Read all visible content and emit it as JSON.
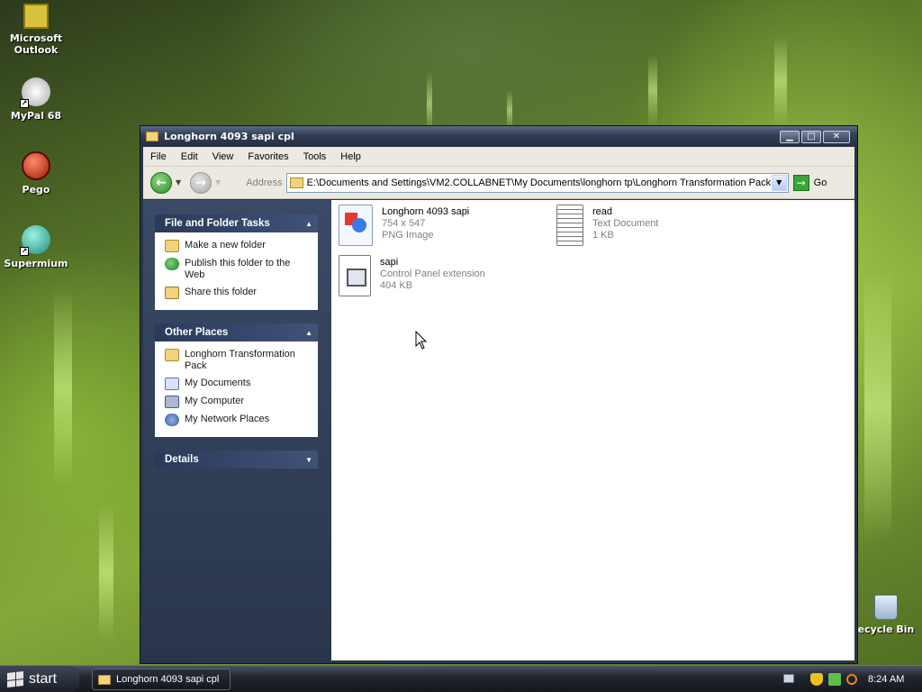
{
  "desktop": {
    "icons": [
      {
        "label": "Microsoft Outlook",
        "icon": "outlook-icon"
      },
      {
        "label": "MyPal 68",
        "icon": "mypal-icon"
      },
      {
        "label": "Pego",
        "icon": "pego-icon"
      },
      {
        "label": "Supermium",
        "icon": "supermium-icon"
      },
      {
        "label": "ecycle Bin",
        "icon": "recycle-bin-icon"
      }
    ]
  },
  "window": {
    "title": "Longhorn 4093 sapi cpl",
    "menu": [
      "File",
      "Edit",
      "View",
      "Favorites",
      "Tools",
      "Help"
    ],
    "address_label": "Address",
    "address_path": "E:\\Documents and Settings\\VM2.COLLABNET\\My Documents\\longhorn tp\\Longhorn Transformation Pack",
    "go_label": "Go",
    "tasks": {
      "file_folder": {
        "header": "File and Folder Tasks",
        "items": [
          "Make a new folder",
          "Publish this folder to the Web",
          "Share this folder"
        ]
      },
      "other_places": {
        "header": "Other Places",
        "items": [
          "Longhorn Transformation Pack",
          "My Documents",
          "My Computer",
          "My Network Places"
        ]
      },
      "details": {
        "header": "Details"
      }
    },
    "files": [
      {
        "name": "Longhorn 4093 sapi",
        "line2": "754 x 547",
        "line3": "PNG Image",
        "icon": "png-image-icon"
      },
      {
        "name": "read",
        "line2": "Text Document",
        "line3": "1 KB",
        "icon": "text-document-icon"
      },
      {
        "name": "sapi",
        "line2": "Control Panel extension",
        "line3": "404 KB",
        "icon": "control-panel-extension-icon"
      }
    ]
  },
  "taskbar": {
    "start_label": "start",
    "task_button": "Longhorn 4093 sapi cpl",
    "clock": "8:24 AM"
  },
  "colors": {
    "window_frame": "#2b3548",
    "task_pane": "#2a354b",
    "taskbar": "#1a1e26"
  }
}
